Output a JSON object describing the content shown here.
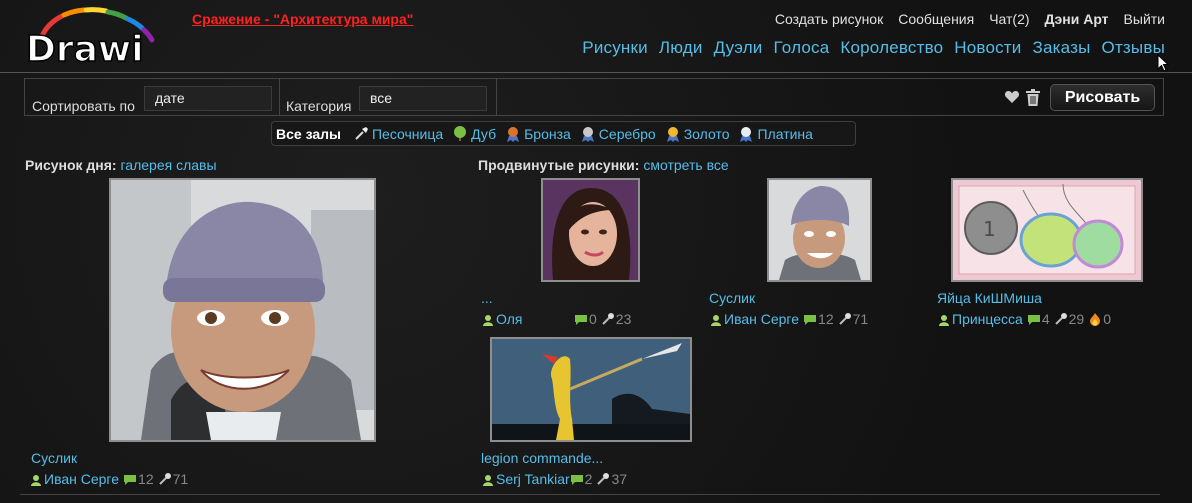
{
  "header": {
    "logo_text": "Drawi",
    "battle_link": "Сражение - \"Архитектура мира\"",
    "top_menu": [
      "Создать рисунок",
      "Сообщения",
      "Чат(2)",
      "Дэни Арт",
      "Выйти"
    ],
    "main_nav": [
      "Рисунки",
      "Люди",
      "Дуэли",
      "Голоса",
      "Королевство",
      "Новости",
      "Заказы",
      "Отзывы"
    ]
  },
  "toolbar": {
    "sort_label": "Сортировать по",
    "sort_value": "дате",
    "category_label": "Категория",
    "category_value": "все",
    "draw_button": "Рисовать"
  },
  "halls": [
    "Все залы",
    "Песочница",
    "Дуб",
    "Бронза",
    "Серебро",
    "Золото",
    "Платина"
  ],
  "drawing_of_day": {
    "title": "Рисунок дня:",
    "link": "галерея славы",
    "caption": "Суслик",
    "author": "Иван Серге",
    "comments": "12",
    "likes": "71"
  },
  "featured": {
    "title": "Продвинутые рисунки:",
    "link": "смотреть все",
    "items": [
      {
        "caption": "...",
        "author": "Оля",
        "comments": "0",
        "likes": "23"
      },
      {
        "caption": "Суслик",
        "author": "Иван Серге",
        "comments": "12",
        "likes": "71"
      },
      {
        "caption": "Яйца КиШМиша",
        "author": "Принцесса",
        "comments": "4",
        "likes": "29",
        "fire": "0"
      },
      {
        "caption": "legion commande...",
        "author": "Serj Tankiar",
        "comments": "2",
        "likes": "37"
      }
    ]
  },
  "colors": {
    "link": "#55bde8",
    "battle": "#ff2020",
    "background": "#151515"
  }
}
